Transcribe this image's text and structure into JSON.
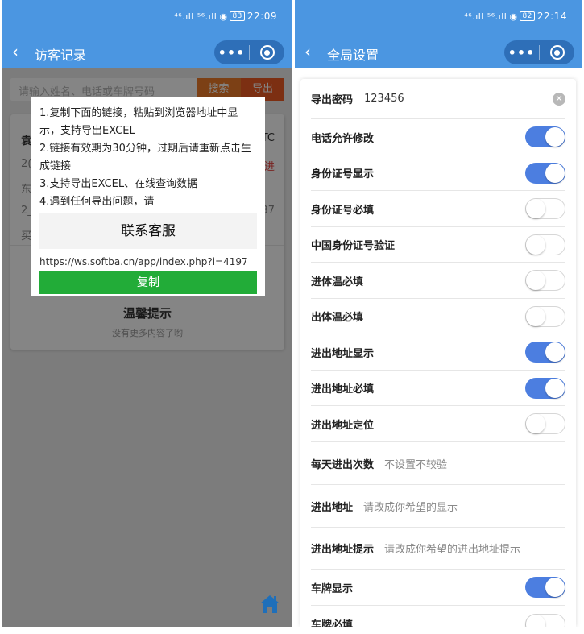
{
  "left": {
    "status": {
      "signal": "⁴⁶.ıll ⁵⁶.ıll",
      "battery": "83",
      "time": "22:09"
    },
    "nav": {
      "back": "‹",
      "title": "访客记录",
      "more": "•••"
    },
    "search": {
      "placeholder": "请输入姓名、电话或车牌号码",
      "search_label": "搜索",
      "export_label": "导出"
    },
    "card_fragments": [
      "袁",
      "2(",
      "东",
      "2_",
      "买",
      "TC",
      "进",
      "37"
    ],
    "tip": {
      "title": "温馨提示",
      "subtitle": "没有更多内容了哟"
    },
    "popup": {
      "lines": [
        "1.复制下面的链接，粘贴到浏览器地址中显示，支持导出EXCEL",
        "2.链接有效期为30分钟，过期后请重新点击生成链接",
        "3.支持导出EXCEL、在线查询数据",
        "4.遇到任何导出问题，请"
      ],
      "contact": "联系客服",
      "link": "https://ws.softba.cn/app/index.php?i=4197",
      "copy_label": "复制"
    }
  },
  "right": {
    "status": {
      "signal": "⁴⁶.ıll ⁵⁶.ıll",
      "battery": "82",
      "time": "22:14"
    },
    "nav": {
      "back": "‹",
      "title": "全局设置",
      "more": "•••"
    },
    "settings": [
      {
        "label": "导出密码",
        "kind": "text",
        "value": "123456"
      },
      {
        "label": "电话允许修改",
        "kind": "toggle",
        "on": true
      },
      {
        "label": "身份证号显示",
        "kind": "toggle",
        "on": true
      },
      {
        "label": "身份证号必填",
        "kind": "toggle",
        "on": false
      },
      {
        "label": "中国身份证号验证",
        "kind": "toggle",
        "on": false
      },
      {
        "label": "进体温必填",
        "kind": "toggle",
        "on": false
      },
      {
        "label": "出体温必填",
        "kind": "toggle",
        "on": false
      },
      {
        "label": "进出地址显示",
        "kind": "toggle",
        "on": true
      },
      {
        "label": "进出地址必填",
        "kind": "toggle",
        "on": true
      },
      {
        "label": "进出地址定位",
        "kind": "toggle",
        "on": false
      },
      {
        "label": "每天进出次数",
        "kind": "input",
        "placeholder": "不设置不较验"
      },
      {
        "label": "进出地址",
        "kind": "input",
        "placeholder": "请改成你希望的显示"
      },
      {
        "label": "进出地址提示",
        "kind": "input",
        "placeholder": "请改成你希望的进出地址提示"
      },
      {
        "label": "车牌显示",
        "kind": "toggle",
        "on": true
      },
      {
        "label": "车牌必填",
        "kind": "toggle",
        "on": false
      }
    ]
  },
  "colors": {
    "nav_blue": "#4b96e1",
    "toggle_on": "#4c7ee0",
    "copy_green": "#22ac38",
    "search_orange": "#ee7b2a",
    "export_red": "#ee5a24"
  }
}
